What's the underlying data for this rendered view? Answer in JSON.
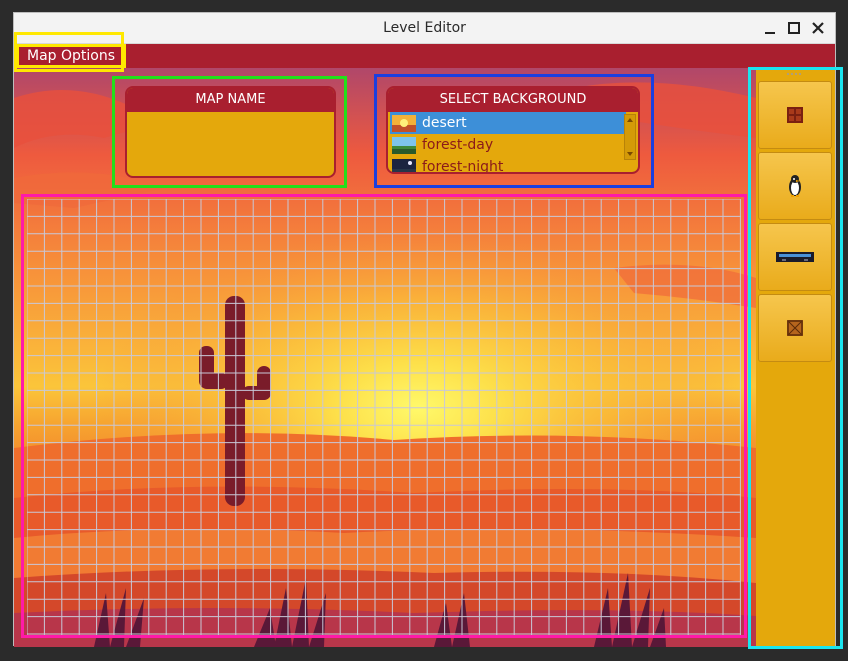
{
  "window": {
    "title": "Level Editor"
  },
  "menu": {
    "map_options": "Map Options"
  },
  "map_name_panel": {
    "header": "MAP NAME",
    "value": ""
  },
  "background_panel": {
    "header": "SELECT BACKGROUND",
    "options": [
      "desert",
      "forest-day",
      "forest-night"
    ],
    "selected": "desert"
  },
  "tools": [
    {
      "icon": "brick-tile-icon"
    },
    {
      "icon": "penguin-character-icon"
    },
    {
      "icon": "platform-icon"
    },
    {
      "icon": "crate-icon"
    }
  ],
  "colors": {
    "accent": "#a91f2f",
    "panel": "#e4a80c",
    "highlight_yellow": "#ffe800",
    "highlight_green": "#22e01a",
    "highlight_blue": "#1a3fe0",
    "highlight_magenta": "#ff1aa8",
    "highlight_cyan": "#1ae5f0"
  }
}
